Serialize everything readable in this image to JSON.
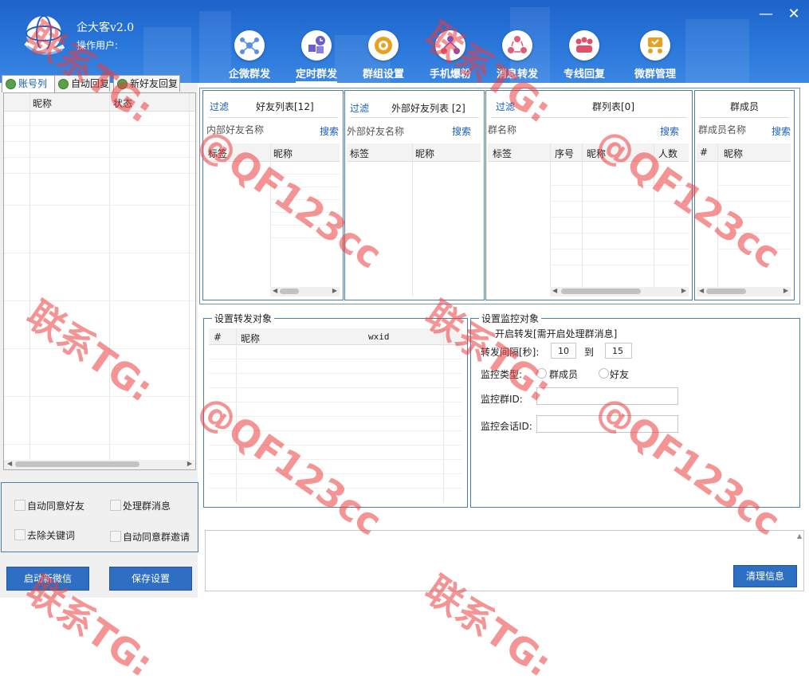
{
  "app": {
    "title": "企大客v2.0",
    "user_label": "操作用户:",
    "minimize_glyph": "—",
    "close_glyph": "✕"
  },
  "toolbar": [
    {
      "label": "企微群发",
      "icon": "share-nodes-icon",
      "color": "#5b8fe0"
    },
    {
      "label": "定时群发",
      "icon": "clock-boxes-icon",
      "color": "#6b5fd0"
    },
    {
      "label": "群组设置",
      "icon": "group-settings-icon",
      "color": "#e8a020"
    },
    {
      "label": "手机爆粉",
      "icon": "network-tree-icon",
      "color": "#7a55c8"
    },
    {
      "label": "消息转发",
      "icon": "forward-cycle-icon",
      "color": "#e05c7a"
    },
    {
      "label": "专线回复",
      "icon": "team-reply-icon",
      "color": "#e0506a"
    },
    {
      "label": "微群管理",
      "icon": "group-manage-icon",
      "color": "#e8a020"
    }
  ],
  "sidebar": {
    "tabs": [
      "账号列",
      "自动回复",
      "新好友回复"
    ],
    "columns": [
      "昵称",
      "状态"
    ],
    "options": [
      "自动同意好友",
      "处理群消息",
      "去除关键词",
      "自动同意群邀请"
    ],
    "start_button": "启动新微信",
    "save_button": "保存设置"
  },
  "friends_panel": {
    "filter": "过滤",
    "title": "好友列表[12]",
    "search_label": "内部好友名称",
    "search_btn": "搜索",
    "columns": [
      "标签",
      "昵称"
    ]
  },
  "external_panel": {
    "filter": "过滤",
    "title": "外部好友列表 [2]",
    "search_label": "外部好友名称",
    "search_btn": "搜索",
    "columns": [
      "标签",
      "昵称"
    ]
  },
  "groups_panel": {
    "filter": "过滤",
    "title": "群列表[0]",
    "search_label": "群名称",
    "search_btn": "搜索",
    "columns": [
      "标签",
      "序号",
      "昵称",
      "人数"
    ]
  },
  "members_panel": {
    "title": "群成员",
    "search_label": "群成员名称",
    "search_btn": "搜索",
    "columns": [
      "#",
      "昵称"
    ]
  },
  "forward_target": {
    "legend": "设置转发对象",
    "columns": [
      "#",
      "昵称",
      "wxid"
    ]
  },
  "monitor": {
    "legend": "设置监控对象",
    "enable_label": "开启转发[需开启处理群消息]",
    "interval_label": "转发间隔[秒]:",
    "interval_from": "10",
    "interval_to_label": "到",
    "interval_to": "15",
    "type_label": "监控类型:",
    "type_options": [
      "群成员",
      "好友"
    ],
    "group_id_label": "监控群ID:",
    "session_id_label": "监控会话ID:"
  },
  "log": {
    "clear_button": "清理信息"
  },
  "watermark": {
    "lines": [
      "联系TG:",
      "@QF123cc"
    ]
  }
}
